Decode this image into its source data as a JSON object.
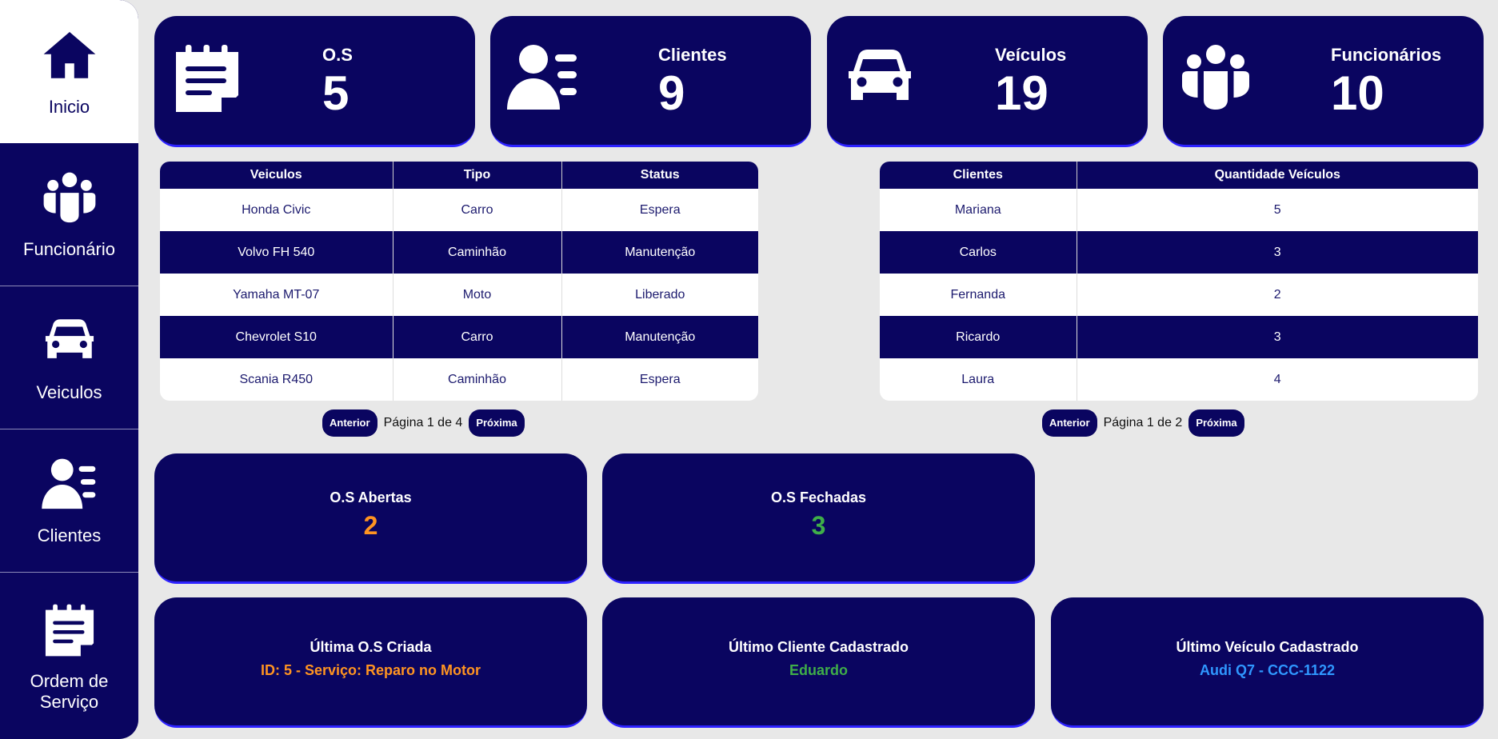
{
  "sidebar": {
    "items": [
      {
        "label": "Inicio",
        "icon": "home-icon"
      },
      {
        "label": "Funcionário",
        "icon": "users-icon"
      },
      {
        "label": "Veiculos",
        "icon": "car-icon"
      },
      {
        "label": "Clientes",
        "icon": "client-icon"
      },
      {
        "label": "Ordem de Serviço",
        "icon": "notepad-icon"
      }
    ]
  },
  "stats": [
    {
      "title": "O.S",
      "value": "5",
      "icon": "notepad-icon"
    },
    {
      "title": "Clientes",
      "value": "9",
      "icon": "client-icon"
    },
    {
      "title": "Veículos",
      "value": "19",
      "icon": "car-icon"
    },
    {
      "title": "Funcionários",
      "value": "10",
      "icon": "users-icon"
    }
  ],
  "vehicles_table": {
    "headers": [
      "Veiculos",
      "Tipo",
      "Status"
    ],
    "rows": [
      [
        "Honda Civic",
        "Carro",
        "Espera"
      ],
      [
        "Volvo FH 540",
        "Caminhão",
        "Manutenção"
      ],
      [
        "Yamaha MT-07",
        "Moto",
        "Liberado"
      ],
      [
        "Chevrolet S10",
        "Carro",
        "Manutenção"
      ],
      [
        "Scania R450",
        "Caminhão",
        "Espera"
      ]
    ],
    "pager": {
      "prev": "Anterior",
      "text": "Página 1 de 4",
      "next": "Próxima"
    }
  },
  "clients_table": {
    "headers": [
      "Clientes",
      "Quantidade Veículos"
    ],
    "rows": [
      [
        "Mariana",
        "5"
      ],
      [
        "Carlos",
        "3"
      ],
      [
        "Fernanda",
        "2"
      ],
      [
        "Ricardo",
        "3"
      ],
      [
        "Laura",
        "4"
      ]
    ],
    "pager": {
      "prev": "Anterior",
      "text": "Página 1 de 2",
      "next": "Próxima"
    }
  },
  "os_open": {
    "title": "O.S Abertas",
    "value": "2",
    "color": "#ff9421"
  },
  "os_closed": {
    "title": "O.S Fechadas",
    "value": "3",
    "color": "#3fae49"
  },
  "last_os": {
    "title": "Última O.S Criada",
    "value": "ID: 5 - Serviço: Reparo no Motor",
    "color": "#ff9421"
  },
  "last_client": {
    "title": "Último Cliente Cadastrado",
    "value": "Eduardo",
    "color": "#3fae49"
  },
  "last_vehicle": {
    "title": "Último Veículo Cadastrado",
    "value": "Audi Q7 - CCC-1122",
    "color": "#2f97ff"
  }
}
